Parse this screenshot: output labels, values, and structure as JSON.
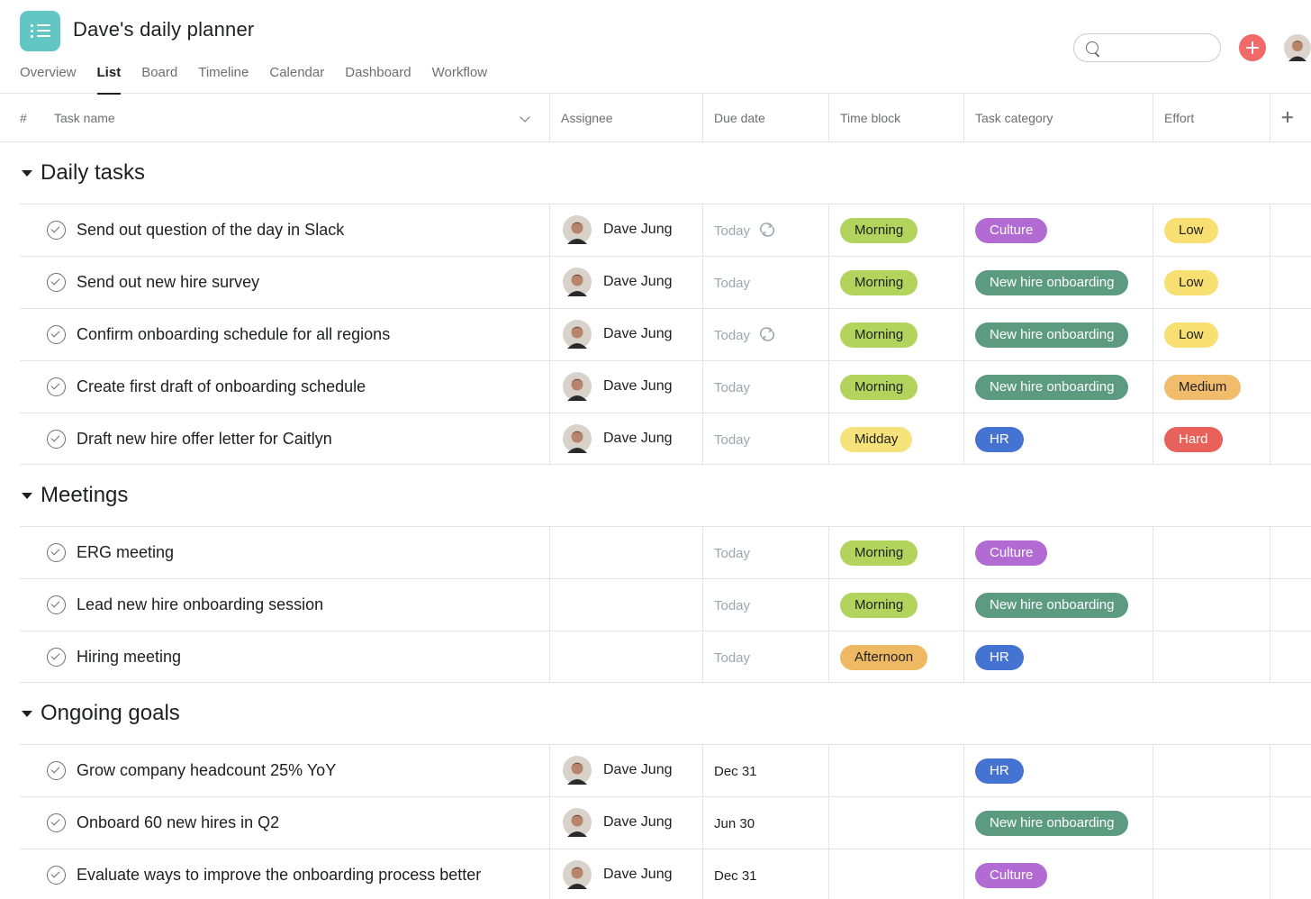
{
  "header": {
    "title": "Dave's daily planner",
    "tabs": [
      "Overview",
      "List",
      "Board",
      "Timeline",
      "Calendar",
      "Dashboard",
      "Workflow"
    ],
    "active_tab": "List",
    "search_placeholder": ""
  },
  "columns": {
    "number": "#",
    "task_name": "Task name",
    "assignee": "Assignee",
    "due_date": "Due date",
    "time_block": "Time block",
    "task_category": "Task category",
    "effort": "Effort"
  },
  "colors": {
    "Morning": {
      "bg": "#b2d35c",
      "fg": "#1e1f21"
    },
    "Midday": {
      "bg": "#f6e27a",
      "fg": "#1e1f21"
    },
    "Afternoon": {
      "bg": "#efb862",
      "fg": "#1e1f21"
    },
    "Culture": {
      "bg": "#b36bd4",
      "fg": "#ffffff"
    },
    "New hire onboarding": {
      "bg": "#5d9b80",
      "fg": "#ffffff"
    },
    "HR": {
      "bg": "#4573d2",
      "fg": "#ffffff"
    },
    "Low": {
      "bg": "#f8df72",
      "fg": "#1e1f21"
    },
    "Medium": {
      "bg": "#f1bd6c",
      "fg": "#1e1f21"
    },
    "Hard": {
      "bg": "#e8615a",
      "fg": "#ffffff"
    }
  },
  "sections": [
    {
      "title": "Daily tasks",
      "tasks": [
        {
          "name": "Send out question of the day in Slack",
          "assignee": "Dave Jung",
          "due": "Today",
          "recurring": true,
          "time_block": "Morning",
          "category": "Culture",
          "effort": "Low"
        },
        {
          "name": "Send out new hire survey",
          "assignee": "Dave Jung",
          "due": "Today",
          "recurring": false,
          "time_block": "Morning",
          "category": "New hire onboarding",
          "effort": "Low"
        },
        {
          "name": "Confirm onboarding schedule for all regions",
          "assignee": "Dave Jung",
          "due": "Today",
          "recurring": true,
          "time_block": "Morning",
          "category": "New hire onboarding",
          "effort": "Low"
        },
        {
          "name": "Create first draft of onboarding schedule",
          "assignee": "Dave Jung",
          "due": "Today",
          "recurring": false,
          "time_block": "Morning",
          "category": "New hire onboarding",
          "effort": "Medium"
        },
        {
          "name": "Draft new hire offer letter for Caitlyn",
          "assignee": "Dave Jung",
          "due": "Today",
          "recurring": false,
          "time_block": "Midday",
          "category": "HR",
          "effort": "Hard"
        }
      ]
    },
    {
      "title": "Meetings",
      "tasks": [
        {
          "name": "ERG meeting",
          "assignee": "",
          "due": "Today",
          "recurring": false,
          "time_block": "Morning",
          "category": "Culture",
          "effort": ""
        },
        {
          "name": "Lead new hire onboarding session",
          "assignee": "",
          "due": "Today",
          "recurring": false,
          "time_block": "Morning",
          "category": "New hire onboarding",
          "effort": ""
        },
        {
          "name": "Hiring meeting",
          "assignee": "",
          "due": "Today",
          "recurring": false,
          "time_block": "Afternoon",
          "category": "HR",
          "effort": ""
        }
      ]
    },
    {
      "title": "Ongoing goals",
      "tasks": [
        {
          "name": "Grow company headcount 25% YoY",
          "assignee": "Dave Jung",
          "due": "Dec 31",
          "due_dark": true,
          "recurring": false,
          "time_block": "",
          "category": "HR",
          "effort": ""
        },
        {
          "name": "Onboard 60 new hires in Q2",
          "assignee": "Dave Jung",
          "due": "Jun 30",
          "due_dark": true,
          "recurring": false,
          "time_block": "",
          "category": "New hire onboarding",
          "effort": ""
        },
        {
          "name": "Evaluate ways to improve the onboarding process better",
          "assignee": "Dave Jung",
          "due": "Dec 31",
          "due_dark": true,
          "recurring": false,
          "time_block": "",
          "category": "Culture",
          "effort": ""
        }
      ]
    }
  ]
}
